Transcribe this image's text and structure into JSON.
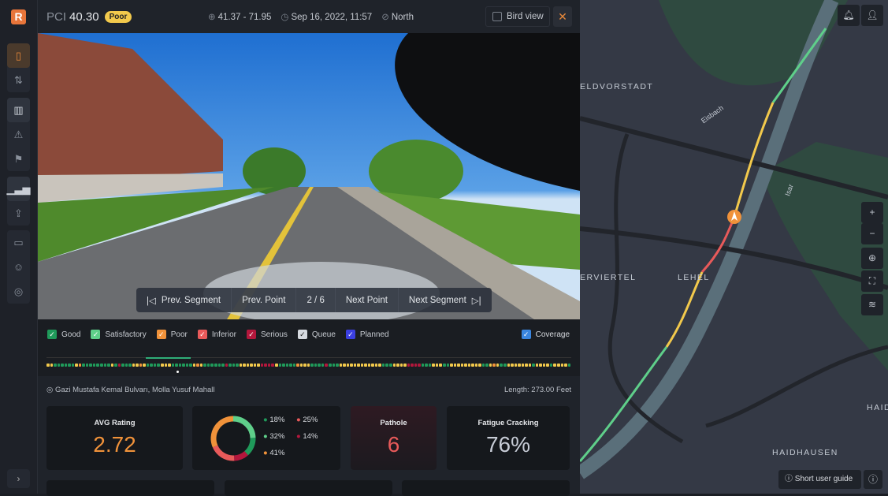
{
  "header": {
    "pci_label": "PCI",
    "pci_value": "40.30",
    "condition": "Poor",
    "coordinates": "41.37 - 71.95",
    "datetime": "Sep 16, 2022, 11:57",
    "direction": "North",
    "bird_view": "Bird view",
    "bird_view_checked": false
  },
  "sidebar": {
    "logo": "R",
    "items": [
      "device",
      "route",
      "map",
      "warning",
      "signpost",
      "chart",
      "upload",
      "folder",
      "users",
      "support"
    ],
    "active": "device"
  },
  "navigation": {
    "prev_segment": "Prev. Segment",
    "prev_point": "Prev. Point",
    "counter": "2 / 6",
    "next_point": "Next Point",
    "next_segment": "Next Segment"
  },
  "legend": {
    "items": [
      {
        "label": "Good",
        "color": "#1f9a5a",
        "checked": true
      },
      {
        "label": "Satisfactory",
        "color": "#5fcf8a",
        "checked": true
      },
      {
        "label": "Poor",
        "color": "#f0923a",
        "checked": true
      },
      {
        "label": "Inferior",
        "color": "#e85a5a",
        "checked": true
      },
      {
        "label": "Serious",
        "color": "#b3173c",
        "checked": true
      },
      {
        "label": "Queue",
        "color": "#d6dae0",
        "checked": true
      },
      {
        "label": "Planned",
        "color": "#3b3fe0",
        "checked": true
      }
    ],
    "coverage": {
      "label": "Coverage",
      "color": "#3a86e0",
      "checked": true
    }
  },
  "segment_points": "yyggggggyoggggggggygrgggyyoyggggyyyggggggyoyggggggrgggyyyyyyrrrrygggggoyyyggggrgggyyyyyyyyyyyygggyyyyrrrrgggyyyggyyyyyyyyyggyoyggyyyyyyygyyyygyyyyg",
  "location": {
    "address": "Gazi Mustafa Kemal Bulvarı, Molla Yusuf Mahall",
    "length": "Length: 273.00 Feet"
  },
  "stats": {
    "avg_rating_label": "AVG Rating",
    "avg_rating": "2.72",
    "pathole_label": "Pathole",
    "pathole": "6",
    "fatigue_label": "Fatigue Cracking",
    "fatigue": "76%"
  },
  "distribution": [
    {
      "value": "18%",
      "color": "#1f9a5a"
    },
    {
      "value": "25%",
      "color": "#e85a5a"
    },
    {
      "value": "32%",
      "color": "#5fcf8a"
    },
    {
      "value": "14%",
      "color": "#b3173c"
    },
    {
      "value": "41%",
      "color": "#f0923a"
    }
  ],
  "map": {
    "labels": [
      "ELDVORSTADT",
      "LEHEL",
      "ERVIERTEL",
      "HAIDHAUSEN",
      "HAID",
      "Eisbach",
      "Isar"
    ],
    "guide": "Short user guide"
  }
}
